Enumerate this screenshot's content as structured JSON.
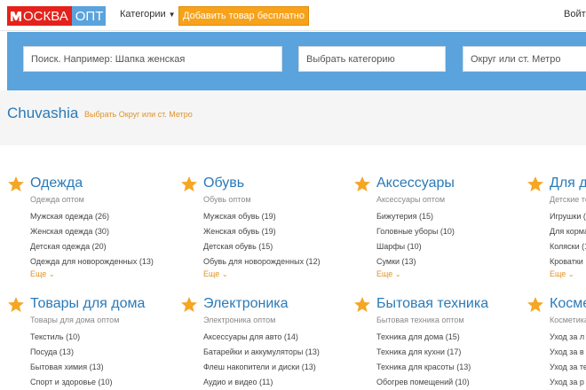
{
  "header": {
    "logo_red": "ОСКВА",
    "logo_blue": "ОПТ",
    "categories_label": "Категории",
    "add_button": "Добавить товар бесплатно",
    "login": "Войти"
  },
  "search": {
    "query_placeholder": "Поиск. Например: Шапка женская",
    "category_placeholder": "Выбрать категорию",
    "district_placeholder": "Округ или ст. Метро"
  },
  "region": {
    "title": "Chuvashia",
    "link": "Выбрать Округ или ст. Метро"
  },
  "colors": {
    "brand_red": "#e4221b",
    "brand_blue": "#5aa3dc",
    "accent_orange": "#f7a21b",
    "link_blue": "#2a7ab8"
  },
  "more_label": "Еще",
  "categories": [
    {
      "title": "Одежда",
      "subtitle": "Одежда оптом",
      "items": [
        "Мужская одежда (26)",
        "Женская одежда (30)",
        "Детская одежда (20)",
        "Одежда для новорожденных (13)"
      ]
    },
    {
      "title": "Обувь",
      "subtitle": "Обувь оптом",
      "items": [
        "Мужская обувь (19)",
        "Женская обувь (19)",
        "Детская обувь (15)",
        "Обувь для новорожденных (12)"
      ]
    },
    {
      "title": "Аксессуары",
      "subtitle": "Аксессуары оптом",
      "items": [
        "Бижутерия (15)",
        "Головные уборы (10)",
        "Шарфы (10)",
        "Сумки (13)"
      ]
    },
    {
      "title": "Для д",
      "subtitle": "Детские то",
      "items": [
        "Игрушки (",
        "Для корма",
        "Коляски (1",
        "Кроватки"
      ]
    },
    {
      "title": "Товары для дома",
      "subtitle": "Товары для дома оптом",
      "items": [
        "Текстиль (10)",
        "Посуда (13)",
        "Бытовая химия (13)",
        "Спорт и здоровье (10)"
      ]
    },
    {
      "title": "Электроника",
      "subtitle": "Электроника оптом",
      "items": [
        "Аксессуары для авто (14)",
        "Батарейки и аккумуляторы (13)",
        "Флеш накопители и диски (13)",
        "Аудио и видео (11)"
      ]
    },
    {
      "title": "Бытовая техника",
      "subtitle": "Бытовая техника оптом",
      "items": [
        "Техника для дома (15)",
        "Техника для кухни (17)",
        "Техника для красоты (13)",
        "Обогрев помещений (10)"
      ]
    },
    {
      "title": "Косме",
      "subtitle": "Косметика",
      "items": [
        "Уход за л",
        "Уход за в",
        "Уход за те",
        "Уход за р"
      ]
    }
  ]
}
